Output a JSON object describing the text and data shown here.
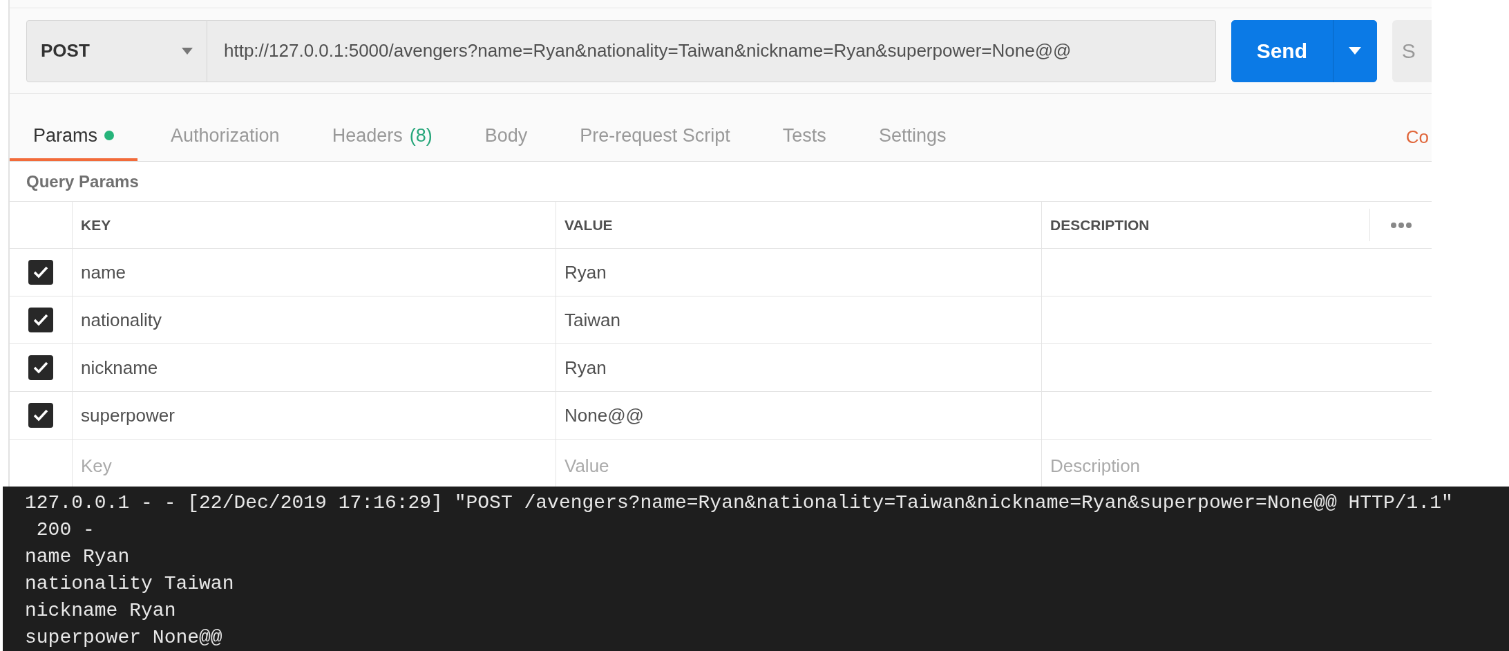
{
  "request": {
    "method": "POST",
    "url": "http://127.0.0.1:5000/avengers?name=Ryan&nationality=Taiwan&nickname=Ryan&superpower=None@@",
    "send": "Send",
    "save": "S"
  },
  "tabs": [
    {
      "label": "Params",
      "selected": true,
      "dot": true
    },
    {
      "label": "Authorization",
      "selected": false
    },
    {
      "label": "Headers",
      "count": "(8)",
      "selected": false
    },
    {
      "label": "Body",
      "selected": false
    },
    {
      "label": "Pre-request Script",
      "selected": false
    },
    {
      "label": "Tests",
      "selected": false
    },
    {
      "label": "Settings",
      "selected": false
    }
  ],
  "side_link": "Co",
  "section_title": "Query Params",
  "table": {
    "columns": [
      "KEY",
      "VALUE",
      "DESCRIPTION"
    ],
    "rows": [
      {
        "checked": true,
        "key": "name",
        "value": "Ryan"
      },
      {
        "checked": true,
        "key": "nationality",
        "value": "Taiwan"
      },
      {
        "checked": true,
        "key": "nickname",
        "value": "Ryan"
      },
      {
        "checked": true,
        "key": "superpower",
        "value": "None@@"
      }
    ],
    "placeholders": [
      "Key",
      "Value",
      "Description"
    ]
  },
  "terminal": [
    "127.0.0.1 - - [22/Dec/2019 17:16:29] \"POST /avengers?name=Ryan&nationality=Taiwan&nickname=Ryan&superpower=None@@ HTTP/1.1\"",
    " 200 -",
    "name Ryan",
    "nationality Taiwan",
    "nickname Ryan",
    "superpower None@@"
  ]
}
